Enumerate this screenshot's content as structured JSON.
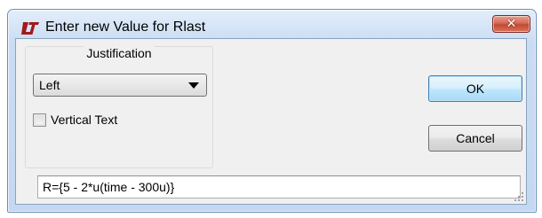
{
  "window": {
    "title": "Enter new Value for Rlast",
    "icon": "lt-logo-icon",
    "close_label": "✕"
  },
  "justification": {
    "label": "Justification",
    "selected": "Left"
  },
  "vertical_text": {
    "label": "Vertical Text",
    "checked": false
  },
  "buttons": {
    "ok": "OK",
    "cancel": "Cancel"
  },
  "value_field": {
    "value": "R={5 - 2*u(time - 300u)}"
  },
  "colors": {
    "titlebar": "#c9dcf3",
    "close_button": "#c24a32",
    "client": "#f0f0f0",
    "default_button_border": "#3c7fb1"
  }
}
